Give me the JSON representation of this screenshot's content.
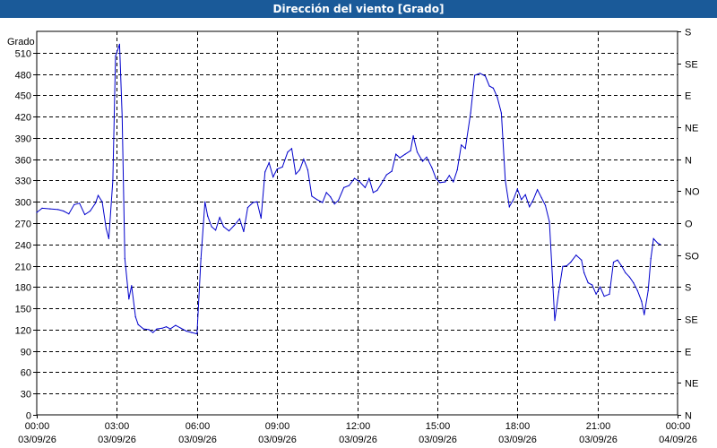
{
  "window": {
    "title": "Dirección del viento [Grado]"
  },
  "chart_data": {
    "type": "line",
    "title": "Dirección del viento [Grado]",
    "ylabel": "Grado",
    "ylim": [
      0,
      540
    ],
    "y_ticks": [
      0,
      30,
      60,
      90,
      120,
      150,
      180,
      210,
      240,
      270,
      300,
      330,
      360,
      390,
      420,
      450,
      480,
      510
    ],
    "right_axis_labels": [
      "N",
      "NE",
      "E",
      "SE",
      "S",
      "SO",
      "O",
      "NO",
      "N",
      "NE",
      "E",
      "SE",
      "S"
    ],
    "x_ticks": [
      {
        "time": "00:00",
        "date": "03/09/26"
      },
      {
        "time": "03:00",
        "date": "03/09/26"
      },
      {
        "time": "06:00",
        "date": "03/09/26"
      },
      {
        "time": "09:00",
        "date": "03/09/26"
      },
      {
        "time": "12:00",
        "date": "03/09/26"
      },
      {
        "time": "15:00",
        "date": "03/09/26"
      },
      {
        "time": "18:00",
        "date": "03/09/26"
      },
      {
        "time": "21:00",
        "date": "03/09/26"
      },
      {
        "time": "00:00",
        "date": "04/09/26"
      }
    ],
    "xlim_hours": [
      0,
      24
    ],
    "grid": true,
    "series": [
      {
        "color": "#0000cc",
        "points": [
          [
            0.0,
            285
          ],
          [
            0.2,
            291
          ],
          [
            0.5,
            290
          ],
          [
            0.8,
            289
          ],
          [
            1.0,
            287
          ],
          [
            1.2,
            283
          ],
          [
            1.4,
            296
          ],
          [
            1.6,
            298
          ],
          [
            1.8,
            282
          ],
          [
            2.0,
            287
          ],
          [
            2.2,
            298
          ],
          [
            2.3,
            309
          ],
          [
            2.45,
            300
          ],
          [
            2.6,
            262
          ],
          [
            2.7,
            248
          ],
          [
            2.85,
            330
          ],
          [
            2.95,
            505
          ],
          [
            3.1,
            522
          ],
          [
            3.2,
            420
          ],
          [
            3.3,
            220
          ],
          [
            3.45,
            163
          ],
          [
            3.55,
            182
          ],
          [
            3.7,
            138
          ],
          [
            3.8,
            127
          ],
          [
            4.0,
            121
          ],
          [
            4.2,
            120
          ],
          [
            4.35,
            116
          ],
          [
            4.5,
            121
          ],
          [
            4.7,
            122
          ],
          [
            4.85,
            124
          ],
          [
            5.0,
            121
          ],
          [
            5.2,
            126
          ],
          [
            5.4,
            122
          ],
          [
            5.6,
            118
          ],
          [
            5.8,
            116
          ],
          [
            6.0,
            114
          ],
          [
            6.15,
            220
          ],
          [
            6.3,
            300
          ],
          [
            6.4,
            280
          ],
          [
            6.55,
            265
          ],
          [
            6.7,
            260
          ],
          [
            6.85,
            278
          ],
          [
            7.0,
            265
          ],
          [
            7.2,
            259
          ],
          [
            7.4,
            267
          ],
          [
            7.6,
            276
          ],
          [
            7.75,
            258
          ],
          [
            7.9,
            292
          ],
          [
            8.1,
            299
          ],
          [
            8.25,
            300
          ],
          [
            8.4,
            277
          ],
          [
            8.55,
            342
          ],
          [
            8.7,
            355
          ],
          [
            8.85,
            335
          ],
          [
            9.0,
            346
          ],
          [
            9.2,
            349
          ],
          [
            9.4,
            370
          ],
          [
            9.55,
            375
          ],
          [
            9.7,
            339
          ],
          [
            9.85,
            345
          ],
          [
            10.0,
            360
          ],
          [
            10.15,
            345
          ],
          [
            10.3,
            308
          ],
          [
            10.5,
            303
          ],
          [
            10.7,
            299
          ],
          [
            10.85,
            313
          ],
          [
            11.0,
            307
          ],
          [
            11.15,
            297
          ],
          [
            11.3,
            302
          ],
          [
            11.5,
            320
          ],
          [
            11.7,
            323
          ],
          [
            11.9,
            333
          ],
          [
            12.1,
            328
          ],
          [
            12.3,
            320
          ],
          [
            12.45,
            333
          ],
          [
            12.6,
            313
          ],
          [
            12.75,
            316
          ],
          [
            12.9,
            325
          ],
          [
            13.1,
            338
          ],
          [
            13.3,
            343
          ],
          [
            13.45,
            367
          ],
          [
            13.6,
            362
          ],
          [
            13.8,
            367
          ],
          [
            14.0,
            372
          ],
          [
            14.1,
            393
          ],
          [
            14.25,
            370
          ],
          [
            14.45,
            357
          ],
          [
            14.6,
            363
          ],
          [
            14.8,
            348
          ],
          [
            14.95,
            333
          ],
          [
            15.1,
            327
          ],
          [
            15.3,
            328
          ],
          [
            15.45,
            337
          ],
          [
            15.6,
            328
          ],
          [
            15.75,
            345
          ],
          [
            15.9,
            380
          ],
          [
            16.05,
            375
          ],
          [
            16.25,
            425
          ],
          [
            16.4,
            478
          ],
          [
            16.6,
            481
          ],
          [
            16.8,
            477
          ],
          [
            16.95,
            463
          ],
          [
            17.1,
            460
          ],
          [
            17.25,
            447
          ],
          [
            17.4,
            425
          ],
          [
            17.55,
            330
          ],
          [
            17.7,
            293
          ],
          [
            17.85,
            303
          ],
          [
            18.0,
            318
          ],
          [
            18.15,
            303
          ],
          [
            18.3,
            310
          ],
          [
            18.45,
            293
          ],
          [
            18.6,
            303
          ],
          [
            18.75,
            317
          ],
          [
            18.9,
            306
          ],
          [
            19.05,
            295
          ],
          [
            19.2,
            272
          ],
          [
            19.4,
            133
          ],
          [
            19.55,
            173
          ],
          [
            19.7,
            209
          ],
          [
            19.85,
            210
          ],
          [
            20.0,
            215
          ],
          [
            20.2,
            225
          ],
          [
            20.4,
            218
          ],
          [
            20.5,
            200
          ],
          [
            20.65,
            186
          ],
          [
            20.8,
            183
          ],
          [
            20.95,
            170
          ],
          [
            21.1,
            180
          ],
          [
            21.25,
            167
          ],
          [
            21.45,
            170
          ],
          [
            21.6,
            215
          ],
          [
            21.75,
            218
          ],
          [
            21.9,
            210
          ],
          [
            22.05,
            200
          ],
          [
            22.2,
            194
          ],
          [
            22.35,
            186
          ],
          [
            22.5,
            175
          ],
          [
            22.65,
            160
          ],
          [
            22.75,
            141
          ],
          [
            22.9,
            175
          ],
          [
            23.0,
            220
          ],
          [
            23.1,
            248
          ],
          [
            23.25,
            242
          ],
          [
            23.35,
            240
          ]
        ]
      }
    ]
  }
}
